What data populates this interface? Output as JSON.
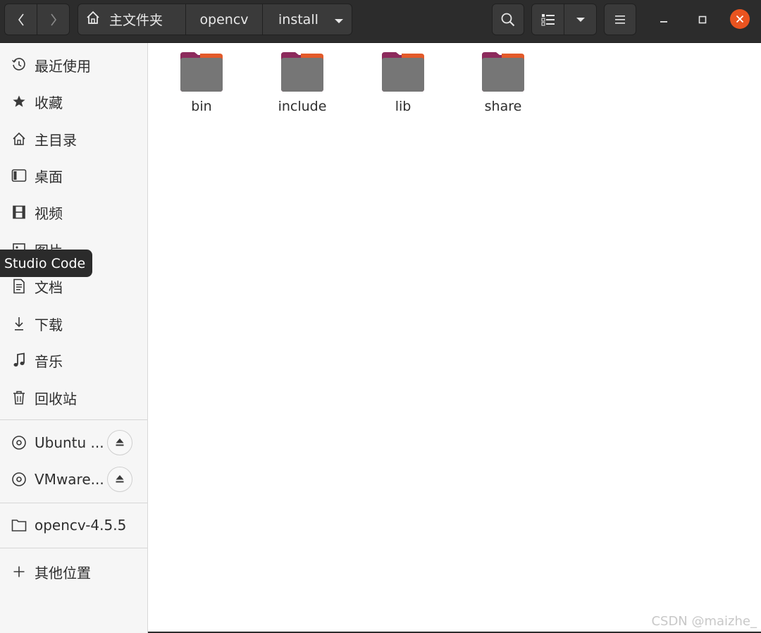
{
  "header": {
    "breadcrumbs": [
      "主文件夹",
      "opencv",
      "install"
    ],
    "icons": {
      "back": "chevron-left-icon",
      "forward": "chevron-right-icon",
      "home": "home-icon",
      "search": "search-icon",
      "view": "list-view-icon",
      "menu": "hamburger-icon"
    },
    "accent_close": "#e95420"
  },
  "sidebar": {
    "places": [
      {
        "label": "最近使用",
        "icon": "clock-icon"
      },
      {
        "label": "收藏",
        "icon": "star-icon"
      },
      {
        "label": "主目录",
        "icon": "home-icon"
      },
      {
        "label": "桌面",
        "icon": "desktop-icon"
      },
      {
        "label": "视频",
        "icon": "film-icon"
      },
      {
        "label": "图片",
        "icon": "picture-icon"
      },
      {
        "label": "文档",
        "icon": "document-icon"
      },
      {
        "label": "下载",
        "icon": "download-icon"
      },
      {
        "label": "音乐",
        "icon": "music-icon"
      },
      {
        "label": "回收站",
        "icon": "trash-icon"
      }
    ],
    "devices": [
      {
        "label": "Ubuntu ...",
        "icon": "disc-icon"
      },
      {
        "label": "VMware...",
        "icon": "disc-icon"
      }
    ],
    "bookmarks": [
      {
        "label": "opencv-4.5.5",
        "icon": "folder-icon"
      }
    ],
    "other": {
      "label": "其他位置",
      "icon": "plus-icon"
    },
    "tooltip": "Studio Code"
  },
  "main": {
    "folders": [
      "bin",
      "include",
      "lib",
      "share"
    ]
  },
  "watermark": "CSDN @maizhe_"
}
